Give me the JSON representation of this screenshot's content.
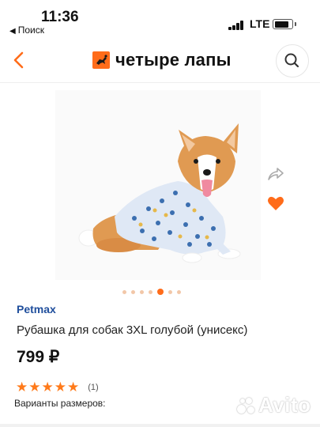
{
  "status_bar": {
    "time": "11:36",
    "back_app": "Поиск",
    "network": "LTE"
  },
  "header": {
    "brand_name": "четыре лапы",
    "accent_color": "#ff6c1a"
  },
  "gallery": {
    "image": "corgi-in-blue-shirt",
    "dots_count": 7,
    "active_dot": 4
  },
  "product": {
    "brand": "Petmax",
    "title": "Рубашка для собак 3XL голубой (унисекс)",
    "price": "799 ₽",
    "rating_stars": 5,
    "reviews": "(1)",
    "sizes_label": "Варианты размеров:"
  },
  "watermark": {
    "text": "Avito"
  }
}
